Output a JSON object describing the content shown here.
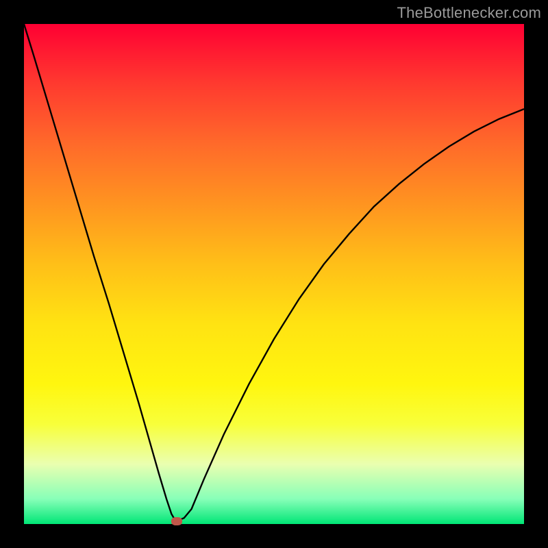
{
  "watermark": "TheBottlenecker.com",
  "chart_data": {
    "type": "line",
    "title": "",
    "xlabel": "",
    "ylabel": "",
    "xlim": [
      0,
      1
    ],
    "ylim": [
      0,
      1
    ],
    "x": [
      0.0,
      0.02,
      0.05,
      0.08,
      0.11,
      0.14,
      0.17,
      0.2,
      0.23,
      0.25,
      0.27,
      0.285,
      0.295,
      0.301,
      0.305,
      0.31,
      0.32,
      0.335,
      0.36,
      0.4,
      0.45,
      0.5,
      0.55,
      0.6,
      0.65,
      0.7,
      0.75,
      0.8,
      0.85,
      0.9,
      0.95,
      1.0
    ],
    "y": [
      1.0,
      0.935,
      0.835,
      0.735,
      0.635,
      0.535,
      0.44,
      0.34,
      0.24,
      0.17,
      0.1,
      0.05,
      0.02,
      0.01,
      0.01,
      0.008,
      0.012,
      0.03,
      0.09,
      0.18,
      0.28,
      0.37,
      0.45,
      0.52,
      0.58,
      0.635,
      0.68,
      0.72,
      0.755,
      0.785,
      0.81,
      0.83
    ],
    "marker": {
      "x": 0.305,
      "y": 0.006
    },
    "note": "x and y are normalized to [0,1] of the plot area; y measured from bottom"
  },
  "colors": {
    "curve": "#000000",
    "dot": "#c0574a",
    "watermark": "#9a9a9a"
  }
}
